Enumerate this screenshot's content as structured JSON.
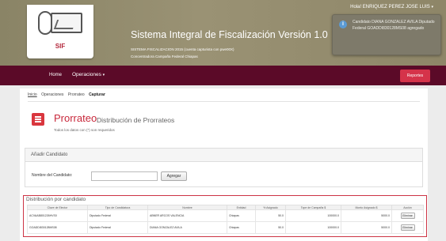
{
  "header": {
    "logo_text": "SIF",
    "title": "Sistema Integral de Fiscalización Versión 1.0",
    "subtitle_line1": "SISTEMA FISCALIZACION 2015 (cuenta capturista con pwe00X)",
    "subtitle_line2": "Concentradora Campaña Federal Chiapas",
    "user_name": "Hola! ENRIQUEZ PEREZ JOSE LUIS",
    "user_caret": "▾"
  },
  "notification": {
    "icon": "info-icon",
    "icon_glyph": "i",
    "text": "Candidato DIANA GONZALEZ AVILA Diputado Federal GOADDI830128MS08 agregado"
  },
  "nav": {
    "home_label": "Home",
    "operaciones_label": "Operaciones",
    "operaciones_caret": "▾",
    "reportes_label": "Reportes"
  },
  "breadcrumb": {
    "item1": "Inicio",
    "item2": "Operaciones",
    "item3": "Prorrateo",
    "current": "Capturar"
  },
  "page": {
    "icon": "list-document-icon",
    "title": "Prorrateo",
    "subtitle": "Distribución de Prorrateos",
    "required_note": "Todos los datos con (*) son requeridos"
  },
  "add_panel": {
    "heading": "Añadir Candidato",
    "field_label": "Nombre del Candidato:",
    "field_value": "",
    "button_label": "Agregar"
  },
  "distribution": {
    "heading": "Distribución por candidato",
    "columns": [
      "Clave de Elector",
      "Tipo de Candidatura",
      "Nombre",
      "Entidad",
      "% Asignado",
      "Tope de Campaña $",
      "Monto Asignado $",
      "Acción"
    ],
    "rows": [
      {
        "clave": "ACVAAB801226HVS0",
        "tipo": "Diputado Federal",
        "nombre": "ABNER ARCOS VALENCIA",
        "entidad": "Chiapas",
        "porcentaje": "50.0",
        "tope": "100000.0",
        "monto": "5000.0",
        "accion": "Eliminar"
      },
      {
        "clave": "GOADDI830128MS08",
        "tipo": "Diputado Federal",
        "nombre": "DIANA GONZALEZ AVILA",
        "entidad": "Chiapas",
        "porcentaje": "50.0",
        "tope": "100000.0",
        "monto": "5000.0",
        "accion": "Eliminar"
      }
    ]
  },
  "colors": {
    "header_bg": "#948c6e",
    "nav_bg": "#5b0a28",
    "accent_red": "#c8283b",
    "reportes_btn": "#d5334a"
  }
}
